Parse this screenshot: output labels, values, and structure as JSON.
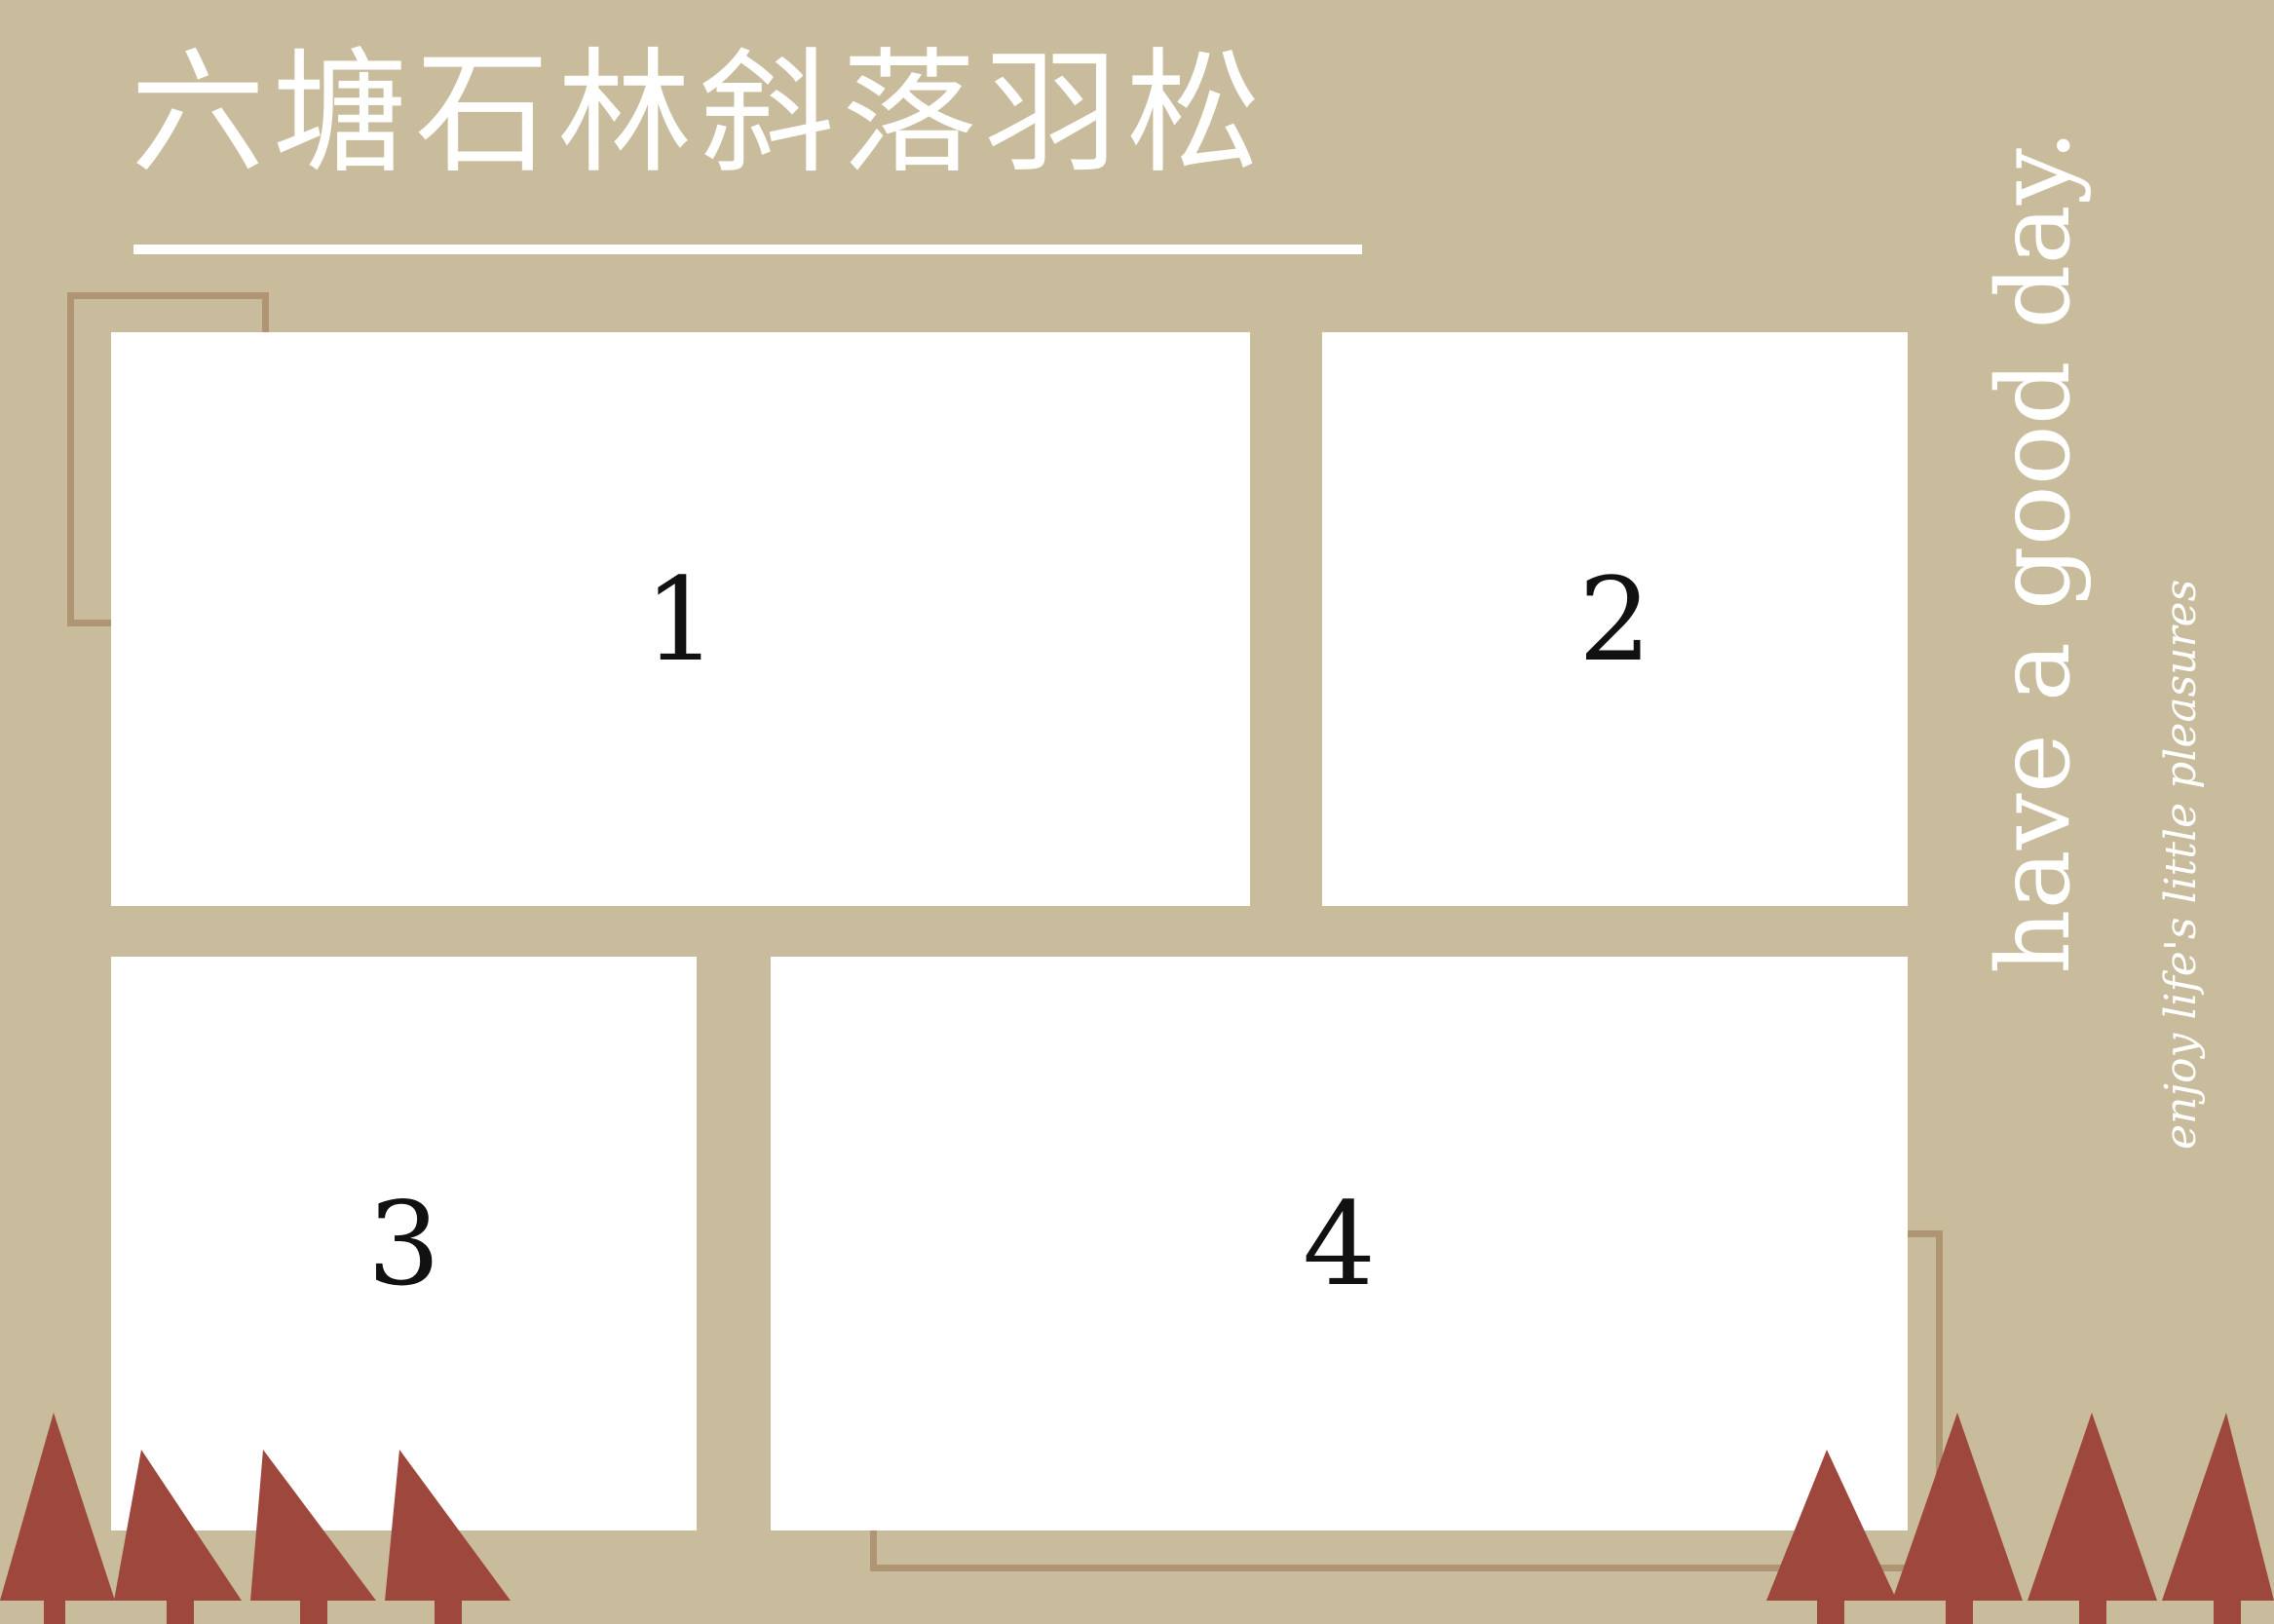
{
  "colors": {
    "background": "#c9bc9c",
    "accent": "#b09575",
    "tree": "#9e473d",
    "white": "#ffffff",
    "number": "#111111"
  },
  "title": "六塘石林斜落羽松",
  "placeholders": [
    "1",
    "2",
    "3",
    "4"
  ],
  "side_text": {
    "main": "have a good day.",
    "sub": "enjoy life's little pleasures"
  },
  "decor": {
    "left_tree_icons": [
      "tree-icon",
      "tree-icon",
      "tree-icon",
      "tree-icon",
      "tree-icon"
    ],
    "right_tree_icons": [
      "tree-icon",
      "tree-icon",
      "tree-icon",
      "tree-icon",
      "tree-icon"
    ]
  }
}
